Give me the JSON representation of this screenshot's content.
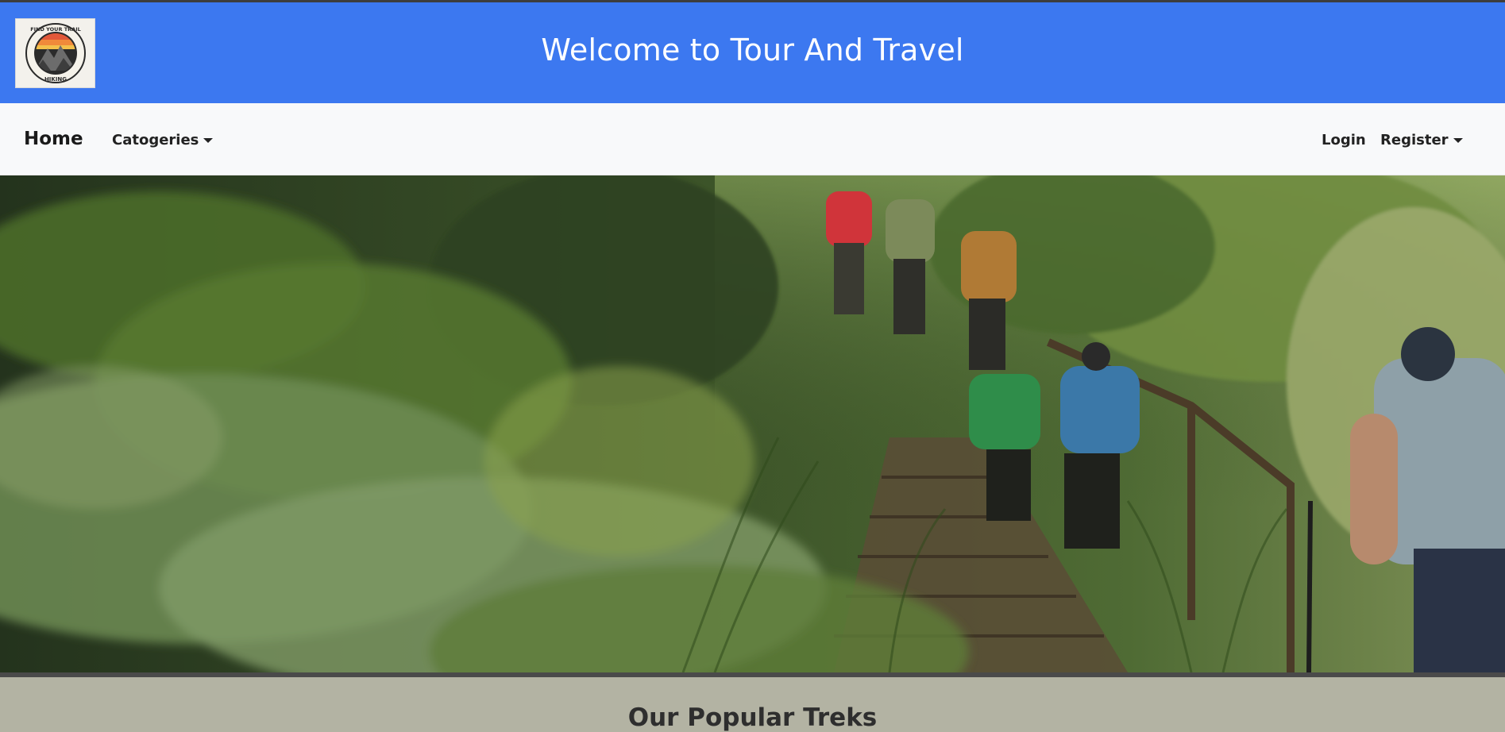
{
  "header": {
    "title": "Welcome to Tour And Travel",
    "logo": {
      "icon": "trail-hiking-logo-icon",
      "top_text": "FIND YOUR TRAIL",
      "bottom_text": "HIKING"
    }
  },
  "nav": {
    "home": "Home",
    "categories": "Catogeries",
    "login": "Login",
    "register": "Register"
  },
  "hero": {
    "image": "hikers-forest-trail-image"
  },
  "section": {
    "title": "Our Popular Treks"
  },
  "colors": {
    "header_bg": "#3c78f0",
    "navbar_bg": "#f8f9fa",
    "section_bg": "#b3b3a3"
  }
}
